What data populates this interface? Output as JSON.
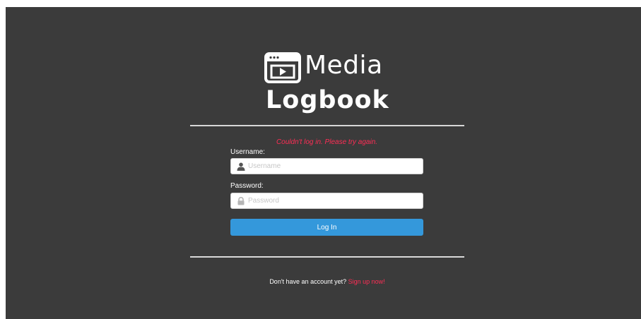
{
  "logo": {
    "line1": "Media",
    "line2": "Logbook",
    "icon": "video-window-icon"
  },
  "form": {
    "error_message": "Couldn't log in. Please try again.",
    "username": {
      "label": "Username:",
      "placeholder": "Username",
      "value": "",
      "icon": "user-icon"
    },
    "password": {
      "label": "Password:",
      "placeholder": "Password",
      "value": "",
      "icon": "lock-icon"
    },
    "submit_label": "Log In"
  },
  "footer": {
    "prompt": "Don't have an account yet?",
    "link_text": "Sign up now!"
  },
  "colors": {
    "background": "#3b3b3b",
    "accent": "#3498db",
    "error": "#ff2d55",
    "text": "#ffffff"
  }
}
